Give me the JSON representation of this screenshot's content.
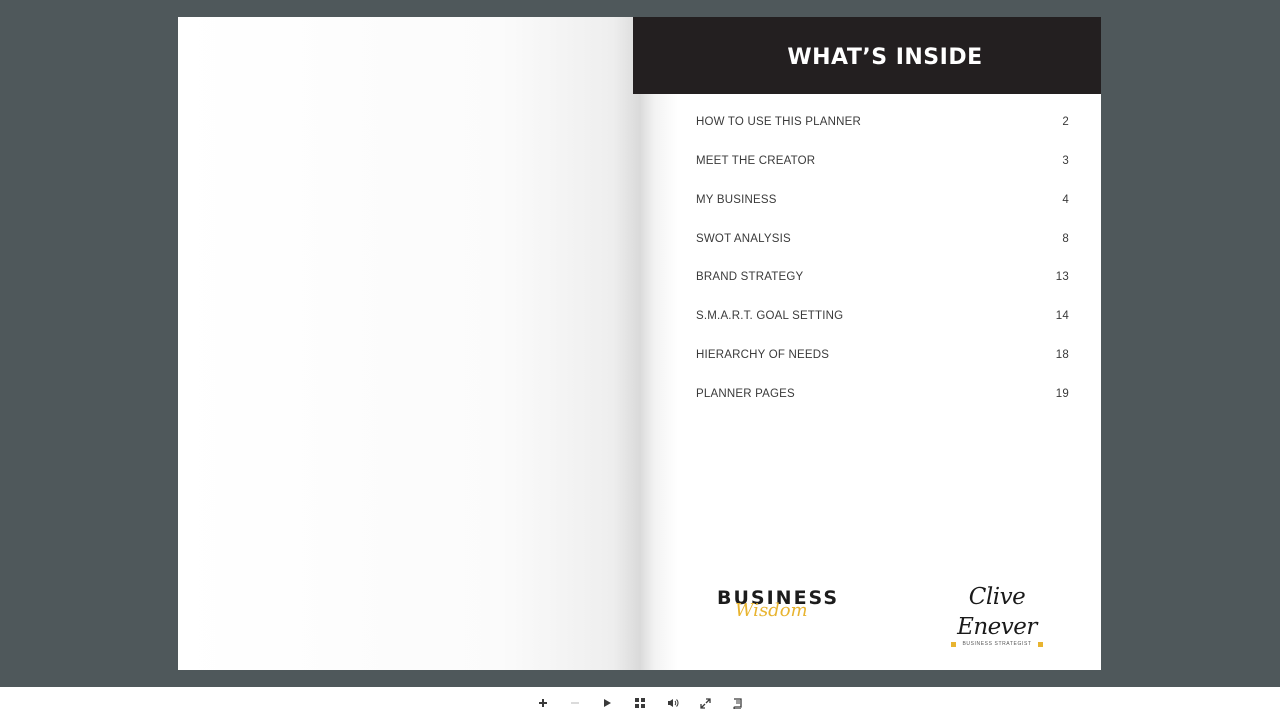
{
  "toc": {
    "title": "WHAT’S INSIDE",
    "items": [
      {
        "label": "HOW TO USE THIS PLANNER",
        "page": "2"
      },
      {
        "label": "MEET THE CREATOR",
        "page": "3"
      },
      {
        "label": "MY BUSINESS",
        "page": "4"
      },
      {
        "label": "SWOT ANALYSIS",
        "page": "8"
      },
      {
        "label": "BRAND STRATEGY",
        "page": "13"
      },
      {
        "label": "S.M.A.R.T. GOAL SETTING",
        "page": "14"
      },
      {
        "label": "HIERARCHY OF NEEDS",
        "page": "18"
      },
      {
        "label": "PLANNER PAGES",
        "page": "19"
      }
    ]
  },
  "logos": {
    "business_wisdom": {
      "word": "BUSINESS",
      "script": "Wisdom"
    },
    "clive_enever": {
      "name": "Clive Enever",
      "subtitle": "BUSINESS STRATEGIST"
    }
  },
  "toolbar": {
    "buttons": [
      {
        "name": "zoom-in-button",
        "icon": "plus-icon",
        "enabled": true
      },
      {
        "name": "zoom-out-button",
        "icon": "minus-icon",
        "enabled": false
      },
      {
        "name": "play-button",
        "icon": "play-icon",
        "enabled": true
      },
      {
        "name": "thumbnails-button",
        "icon": "grid-icon",
        "enabled": true
      },
      {
        "name": "sound-button",
        "icon": "speaker-icon",
        "enabled": true
      },
      {
        "name": "fullscreen-button",
        "icon": "expand-icon",
        "enabled": true
      },
      {
        "name": "table-of-contents-button",
        "icon": "book-icon",
        "enabled": true
      }
    ]
  },
  "colors": {
    "background": "#4f585b",
    "header": "#231f20",
    "accent": "#e8b430"
  }
}
